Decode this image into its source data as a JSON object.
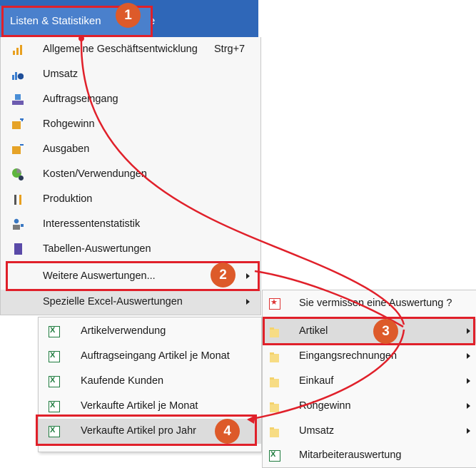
{
  "menubar": {
    "active": "Listen & Statistiken",
    "next_fragment": "ilfe"
  },
  "main_menu": {
    "items": [
      {
        "label": "Allgemeine Geschäftsentwicklung",
        "shortcut": "Strg+7",
        "icon": "bar-chart-icon"
      },
      {
        "label": "Umsatz",
        "icon": "revenue-chart-icon"
      },
      {
        "label": "Auftragseingang",
        "icon": "inbox-tray-icon"
      },
      {
        "label": "Rohgewinn",
        "icon": "folder-plus-icon"
      },
      {
        "label": "Ausgaben",
        "icon": "folder-minus-icon"
      },
      {
        "label": "Kosten/Verwendungen",
        "icon": "pie-chart-icon"
      },
      {
        "label": "Produktion",
        "icon": "tools-icon"
      },
      {
        "label": "Interessentenstatistik",
        "icon": "person-stats-icon"
      },
      {
        "label": "Tabellen-Auswertungen",
        "icon": "document-icon"
      },
      {
        "label": "Weitere Auswertungen...",
        "has_submenu": true
      },
      {
        "label": "Spezielle Excel-Auswertungen",
        "has_submenu": true
      }
    ]
  },
  "excel_submenu": {
    "items": [
      {
        "label": "Artikelverwendung"
      },
      {
        "label": "Auftragseingang Artikel je Monat"
      },
      {
        "label": "Kaufende Kunden"
      },
      {
        "label": "Verkaufte Artikel je Monat"
      },
      {
        "label": "Verkaufte Artikel pro Jahr"
      }
    ]
  },
  "weitere_submenu": {
    "items": [
      {
        "label": "Sie vermissen eine Auswertung ?",
        "icon": "pdf-icon"
      },
      {
        "label": "Artikel",
        "icon": "folder-icon",
        "has_submenu": true
      },
      {
        "label": "Eingangsrechnungen",
        "icon": "folder-icon",
        "has_submenu": true
      },
      {
        "label": "Einkauf",
        "icon": "folder-icon",
        "has_submenu": true
      },
      {
        "label": "Rohgewinn",
        "icon": "folder-icon",
        "has_submenu": true
      },
      {
        "label": "Umsatz",
        "icon": "folder-icon",
        "has_submenu": true
      },
      {
        "label": "Mitarbeiterauswertung",
        "icon": "excel-icon"
      }
    ]
  },
  "callouts": [
    "1",
    "2",
    "3",
    "4"
  ],
  "colors": {
    "menubar": "#2f67b8",
    "highlight": "#e0202a",
    "badge": "#dd5a2a"
  }
}
